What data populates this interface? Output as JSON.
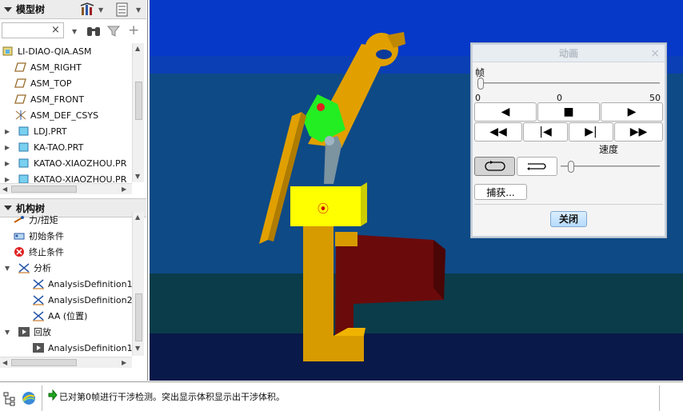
{
  "model_tree": {
    "title": "模型树",
    "filter_placeholder": "",
    "items": [
      {
        "label": "LI-DIAO-QIA.ASM",
        "icon": "assembly-icon",
        "expand": ""
      },
      {
        "label": "ASM_RIGHT",
        "icon": "datum-plane-icon",
        "expand": ""
      },
      {
        "label": "ASM_TOP",
        "icon": "datum-plane-icon",
        "expand": ""
      },
      {
        "label": "ASM_FRONT",
        "icon": "datum-plane-icon",
        "expand": ""
      },
      {
        "label": "ASM_DEF_CSYS",
        "icon": "csys-icon",
        "expand": ""
      },
      {
        "label": "LDJ.PRT",
        "icon": "part-icon",
        "expand": "▶"
      },
      {
        "label": "KA-TAO.PRT",
        "icon": "part-icon",
        "expand": "▶"
      },
      {
        "label": "KATAO-XIAOZHOU.PR",
        "icon": "part-icon",
        "expand": "▶"
      },
      {
        "label": "KATAO-XIAOZHOU.PR",
        "icon": "part-icon",
        "expand": "▶"
      }
    ]
  },
  "mechanism_tree": {
    "title": "机构树",
    "items": [
      {
        "label": "力/扭矩",
        "icon": "force-icon",
        "expand": "",
        "indent": 1
      },
      {
        "label": "初始条件",
        "icon": "initial-condition-icon",
        "expand": "",
        "indent": 1
      },
      {
        "label": "终止条件",
        "icon": "termination-icon",
        "expand": "",
        "indent": 1
      },
      {
        "label": "分析",
        "icon": "analysis-icon",
        "expand": "▼",
        "indent": 1
      },
      {
        "label": "AnalysisDefinition1 (",
        "icon": "analysis-icon",
        "expand": "",
        "indent": 2
      },
      {
        "label": "AnalysisDefinition2 (",
        "icon": "analysis-icon",
        "expand": "",
        "indent": 2
      },
      {
        "label": "AA (位置)",
        "icon": "analysis-icon",
        "expand": "",
        "indent": 2
      },
      {
        "label": "回放",
        "icon": "playback-icon",
        "expand": "▼",
        "indent": 1
      },
      {
        "label": "AnalysisDefinition1",
        "icon": "playback-icon",
        "expand": "",
        "indent": 2
      }
    ]
  },
  "status": {
    "message": "已对第0帧进行干涉检测。突出显示体积显示出干涉体积。"
  },
  "animation_dialog": {
    "title": "动画",
    "frame_label": "帧",
    "frame_min": "0",
    "frame_current": "0",
    "frame_max": "50",
    "frame_value": 0,
    "speed_label": "速度",
    "capture_label": "捕获...",
    "close_label": "关闭"
  },
  "colors": {
    "viewport_bg": "#0b3a9a",
    "part_orange": "#e1a000",
    "part_yellow": "#ffff00",
    "part_green": "#22ee22",
    "part_darkred": "#6b0a0a"
  }
}
